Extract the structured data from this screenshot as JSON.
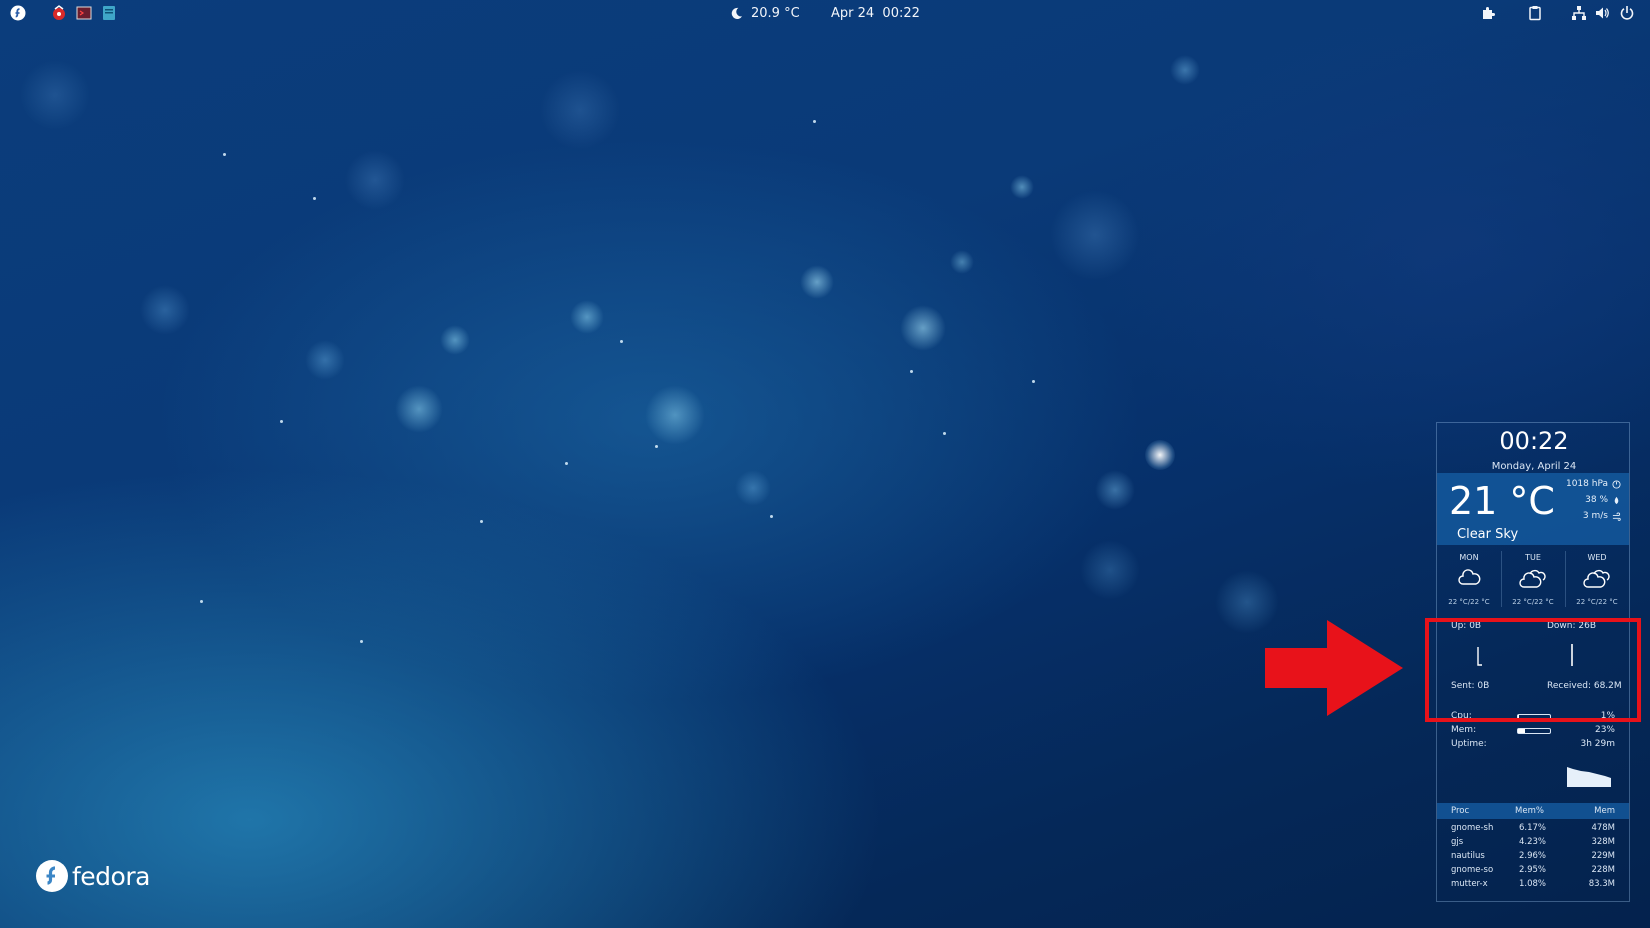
{
  "topbar": {
    "weather_temp": "20.9 °C",
    "date_time": "Apr 24  00:22",
    "icons": [
      "fedora-activities-icon",
      "app-icon-1",
      "app-icon-2",
      "app-icon-3",
      "extensions-icon",
      "clipboard-icon",
      "network-icon",
      "volume-icon",
      "power-icon"
    ]
  },
  "desktop": {
    "logo_text": "fedora"
  },
  "widget": {
    "clock": "00:22",
    "date": "Monday, April 24",
    "weather": {
      "temp": "21 °C",
      "condition": "Clear Sky",
      "pressure": "1018 hPa",
      "humidity": "38 %",
      "wind": "3 m/s"
    },
    "forecast": [
      {
        "day": "MON",
        "icon": "cloud-icon",
        "temps": "22 °C/22 °C"
      },
      {
        "day": "TUE",
        "icon": "clouds-icon",
        "temps": "22 °C/22 °C"
      },
      {
        "day": "WED",
        "icon": "clouds-icon",
        "temps": "22 °C/22 °C"
      }
    ],
    "network": {
      "up": "Up: 0B",
      "down": "Down: 26B",
      "sent": "Sent: 0B",
      "received": "Received: 68.2M"
    },
    "system": {
      "cpu_label": "Cpu:",
      "cpu_value": "1%",
      "cpu_fraction": 0.01,
      "mem_label": "Mem:",
      "mem_value": "23%",
      "mem_fraction": 0.23,
      "uptime_label": "Uptime:",
      "uptime_value": "3h 29m"
    },
    "processes": {
      "headers": [
        "Proc",
        "Mem%",
        "Mem"
      ],
      "rows": [
        [
          "gnome-sh",
          "6.17%",
          "478M"
        ],
        [
          "gjs",
          "4.23%",
          "328M"
        ],
        [
          "nautilus",
          "2.96%",
          "229M"
        ],
        [
          "gnome-so",
          "2.95%",
          "228M"
        ],
        [
          "mutter-x",
          "1.08%",
          "83.3M"
        ]
      ]
    }
  },
  "annotation": {
    "highlight_color": "#e8121a"
  }
}
